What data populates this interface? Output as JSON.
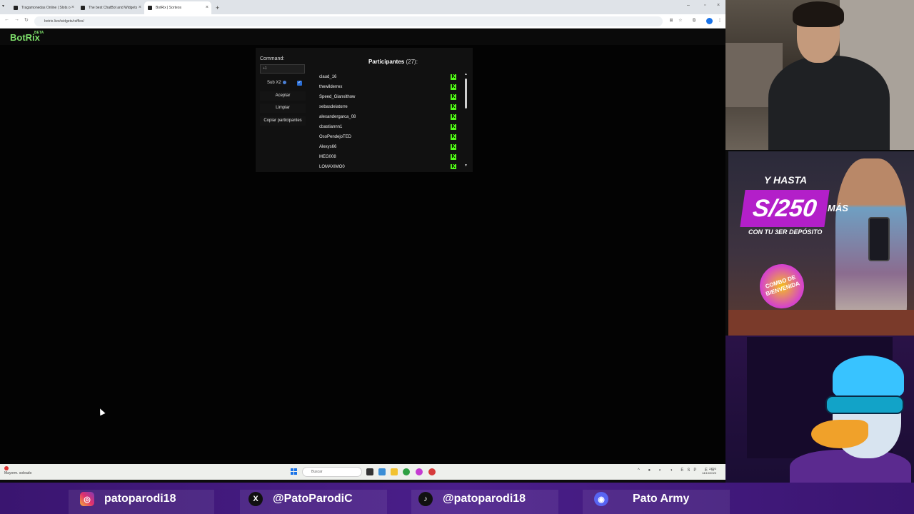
{
  "browser": {
    "tabs": [
      {
        "title": "Tragamonedas Online | Slots o",
        "active": false
      },
      {
        "title": "The best ChatBot and Widgets",
        "active": false
      },
      {
        "title": "BotRix | Sorteos",
        "active": true
      }
    ],
    "url": "botrix.live/widgets/raffles/"
  },
  "site": {
    "logo": "BotRix",
    "logo_badge": "BETA"
  },
  "raffle": {
    "command_label": "Command:",
    "command_value": "+1",
    "sub_label": "Sub X2",
    "sub_checked": true,
    "buttons": {
      "accept": "Aceptar",
      "clear": "Limpiar",
      "copy": "Copiar participantes"
    },
    "participants_title": "Participantes",
    "participants_count": "(27):",
    "participants": [
      "claud_16",
      "thewilderrex",
      "Speed_Gianxithow",
      "sebasdelatorre",
      "alexandergarca_08",
      "cbastiannn1",
      "OsoPendejoTED",
      "Alexys66",
      "MEG008",
      "LOMAXIMO0"
    ],
    "platform_badge": "K",
    "accent": "#53fc18"
  },
  "taskbar": {
    "weather": "Mayorm. soleado",
    "search_placeholder": "Buscar",
    "tray": "ESP ES",
    "clock_time": "22:23",
    "clock_date": "14/10/2023"
  },
  "promo": {
    "line1": "Y HASTA",
    "amount": "S/250",
    "amount_suffix": "MÁS",
    "line3": "CON TU 3ER DEPÓSITO",
    "badge": "COMBO DE BIENVENIDA"
  },
  "social": [
    {
      "icon": "instagram-icon",
      "handle": "patoparodi18"
    },
    {
      "icon": "x-icon",
      "handle": "@PatoParodiC"
    },
    {
      "icon": "tiktok-icon",
      "handle": "@patoparodi18"
    },
    {
      "icon": "discord-icon",
      "handle": "Pato Army"
    }
  ]
}
